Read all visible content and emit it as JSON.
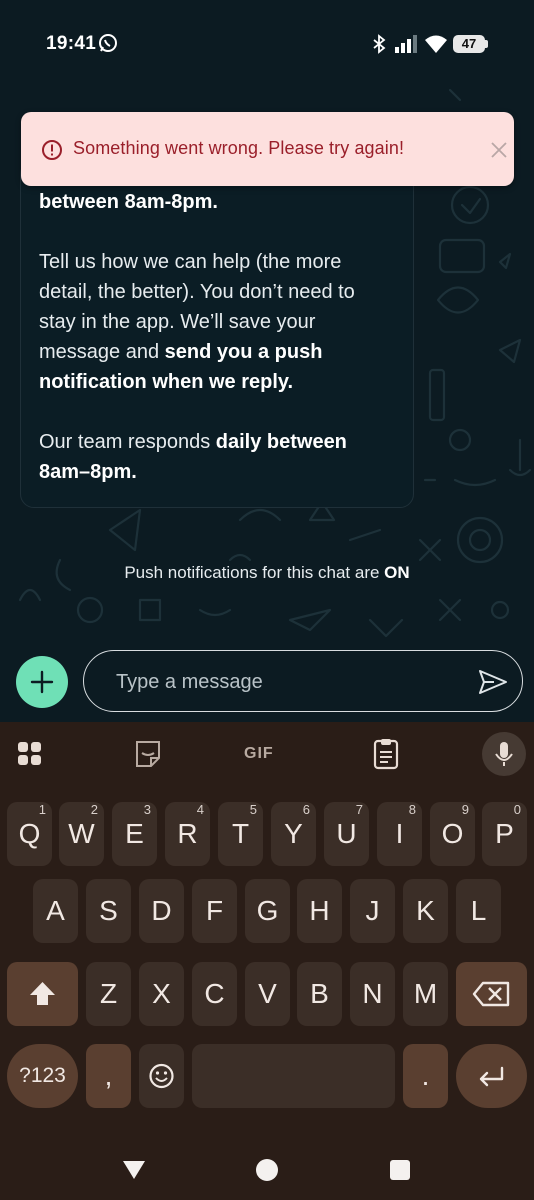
{
  "status_bar": {
    "time": "19:41",
    "battery": "47",
    "icons": [
      "whatsapp-icon",
      "bluetooth-icon",
      "signal-icon",
      "wifi-icon",
      "battery-icon"
    ]
  },
  "toast": {
    "message": "Something went wrong. Please try again!",
    "icons": [
      "alert-circle-icon",
      "close-icon"
    ],
    "colors": {
      "background": "#fde0de",
      "text": "#9a1f2a"
    }
  },
  "bubble": {
    "line1_bold": "between 8am-8pm.",
    "para2_plain": "Tell us how we can help (the more detail, the better). You don’t need to stay in the app. We’ll save your message and ",
    "para2_bold": "send you a push notification when we reply.",
    "para3_plain": "Our team responds ",
    "para3_bold": "daily between 8am–8pm."
  },
  "push_note": {
    "text": "Push notifications for this chat are ",
    "state": "ON"
  },
  "composer": {
    "placeholder": "Type a message",
    "add_icon": "plus-icon",
    "send_icon": "send-icon",
    "accent": "#6fe0b6"
  },
  "keyboard": {
    "toolbar": {
      "gif_label": "GIF",
      "icons": [
        "apps-grid-icon",
        "sticker-icon",
        "clipboard-icon",
        "mic-icon"
      ]
    },
    "row1": [
      {
        "key": "Q",
        "hint": "1"
      },
      {
        "key": "W",
        "hint": "2"
      },
      {
        "key": "E",
        "hint": "3"
      },
      {
        "key": "R",
        "hint": "4"
      },
      {
        "key": "T",
        "hint": "5"
      },
      {
        "key": "Y",
        "hint": "6"
      },
      {
        "key": "U",
        "hint": "7"
      },
      {
        "key": "I",
        "hint": "8"
      },
      {
        "key": "O",
        "hint": "9"
      },
      {
        "key": "P",
        "hint": "0"
      }
    ],
    "row2": [
      "A",
      "S",
      "D",
      "F",
      "G",
      "H",
      "J",
      "K",
      "L"
    ],
    "row3": [
      "Z",
      "X",
      "C",
      "V",
      "B",
      "N",
      "M"
    ],
    "row4": {
      "symbols": "?123",
      "comma": ",",
      "period": "."
    },
    "colors": {
      "background": "#2a1d17",
      "key": "#3b2e27",
      "special_key": "#5a3f30"
    }
  },
  "nav_bar": {
    "icons": [
      "back-icon",
      "home-icon",
      "recents-icon"
    ]
  }
}
